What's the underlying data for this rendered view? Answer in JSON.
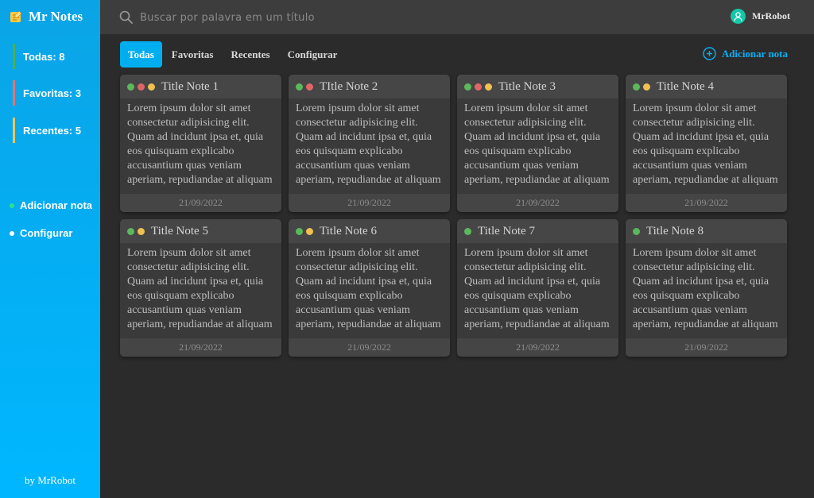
{
  "app": {
    "title": "Mr Notes",
    "byline": "by MrRobot"
  },
  "sidebar": {
    "counters": [
      {
        "label": "Todas: 8",
        "color": "#4caf50"
      },
      {
        "label": "Favoritas: 3",
        "color": "#e57373"
      },
      {
        "label": "Recentes: 5",
        "color": "#f2c35a"
      }
    ],
    "actions": [
      {
        "label": "Adicionar nota",
        "dot_color": "#2fe089"
      },
      {
        "label": "Configurar",
        "dot_color": "#ffffff"
      }
    ]
  },
  "search": {
    "placeholder": "Buscar por palavra em um título"
  },
  "user": {
    "name": "MrRobot"
  },
  "tabs": [
    "Todas",
    "Favoritas",
    "Recentes",
    "Configurar"
  ],
  "add_note": {
    "label": "Adicionar nota"
  },
  "colors": {
    "green": "#5cb85c",
    "red": "#e06666",
    "yellow": "#f0c050"
  },
  "notes": [
    {
      "title": "Title Note 1",
      "tags": [
        "green",
        "red",
        "yellow"
      ],
      "body": "Lorem ipsum dolor sit amet consectetur adipisicing elit. Quam ad incidunt ipsa et, quia eos quisquam explicabo accusantium quas veniam aperiam, repudiandae at aliquam",
      "date": "21/09/2022"
    },
    {
      "title": "TItle Note 2",
      "tags": [
        "green",
        "red"
      ],
      "body": "Lorem ipsum dolor sit amet consectetur adipisicing elit. Quam ad incidunt ipsa et, quia eos quisquam explicabo accusantium quas veniam aperiam, repudiandae at aliquam",
      "date": "21/09/2022"
    },
    {
      "title": "Title Note 3",
      "tags": [
        "green",
        "red",
        "yellow"
      ],
      "body": "Lorem ipsum dolor sit amet consectetur adipisicing elit. Quam ad incidunt ipsa et, quia eos quisquam explicabo accusantium quas veniam aperiam, repudiandae at aliquam",
      "date": "21/09/2022"
    },
    {
      "title": "Title Note 4",
      "tags": [
        "green",
        "yellow"
      ],
      "body": "Lorem ipsum dolor sit amet consectetur adipisicing elit. Quam ad incidunt ipsa et, quia eos quisquam explicabo accusantium quas veniam aperiam, repudiandae at aliquam",
      "date": "21/09/2022"
    },
    {
      "title": "Title Note 5",
      "tags": [
        "green",
        "yellow"
      ],
      "body": "Lorem ipsum dolor sit amet consectetur adipisicing elit. Quam ad incidunt ipsa et, quia eos quisquam explicabo accusantium quas veniam aperiam, repudiandae at aliquam",
      "date": "21/09/2022"
    },
    {
      "title": "Title Note 6",
      "tags": [
        "green",
        "yellow"
      ],
      "body": "Lorem ipsum dolor sit amet consectetur adipisicing elit. Quam ad incidunt ipsa et, quia eos quisquam explicabo accusantium quas veniam aperiam, repudiandae at aliquam",
      "date": "21/09/2022"
    },
    {
      "title": "Title Note 7",
      "tags": [
        "green"
      ],
      "body": "Lorem ipsum dolor sit amet consectetur adipisicing elit. Quam ad incidunt ipsa et, quia eos quisquam explicabo accusantium quas veniam aperiam, repudiandae at aliquam",
      "date": "21/09/2022"
    },
    {
      "title": "Title Note 8",
      "tags": [
        "green"
      ],
      "body": "Lorem ipsum dolor sit amet consectetur adipisicing elit. Quam ad incidunt ipsa et, quia eos quisquam explicabo accusantium quas veniam aperiam, repudiandae at aliquam",
      "date": "21/09/2022"
    }
  ]
}
